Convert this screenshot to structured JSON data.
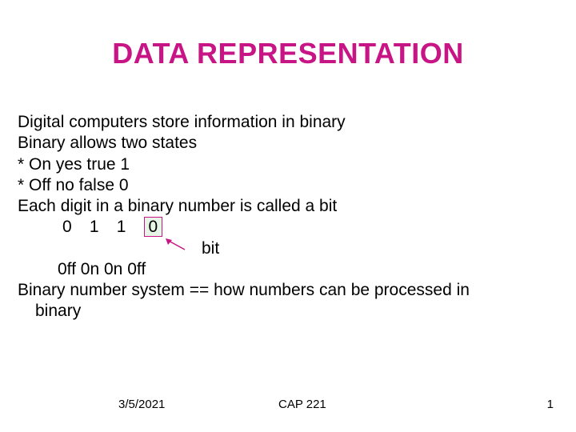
{
  "title": "DATA REPRESENTATION",
  "lines": {
    "l1": "Digital computers store information in binary",
    "l2": "Binary allows two states",
    "l3": "* On   yes   true   1",
    "l4": "* Off   no    false   0",
    "l5": "Each digit in a binary number is called a bit"
  },
  "bits": {
    "b1": "0",
    "b2": "1",
    "b3": "1",
    "b4": "0"
  },
  "bit_label": "bit",
  "onoff": "0ff  0n  0n  0ff",
  "closing_a": "Binary number system == how numbers can be processed in",
  "closing_b": "binary",
  "footer": {
    "date": "3/5/2021",
    "course": "CAP 221",
    "page": "1"
  },
  "colors": {
    "accent": "#c71585"
  }
}
